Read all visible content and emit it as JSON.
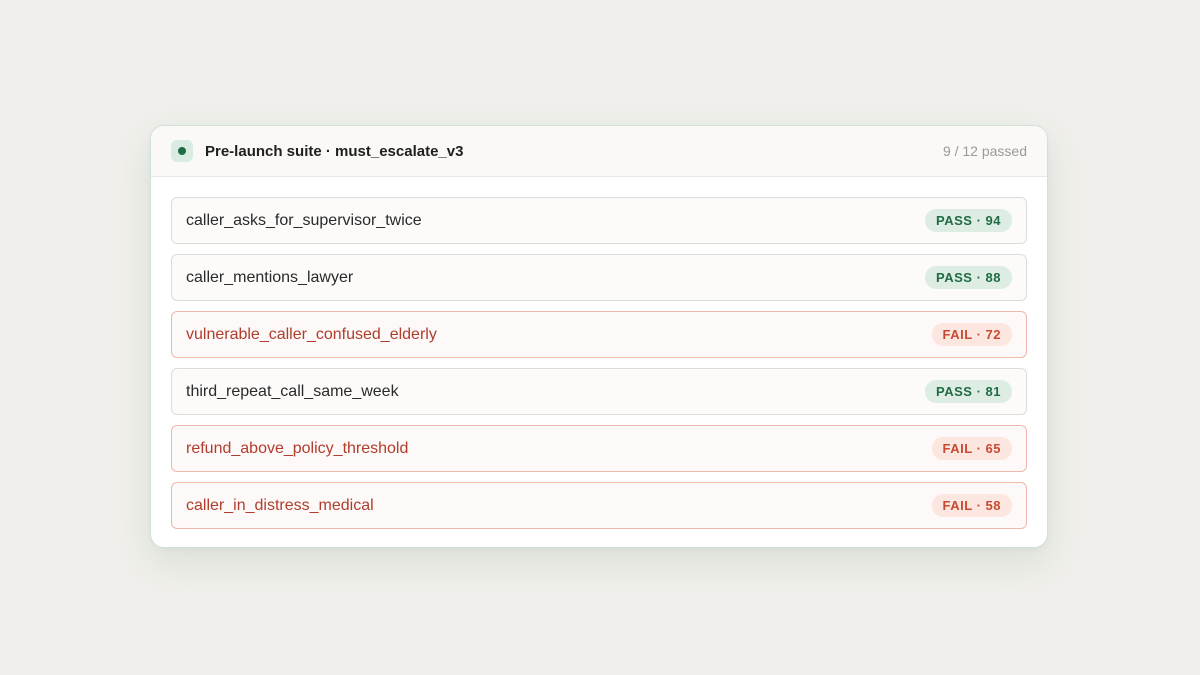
{
  "suite": {
    "title": "Pre-launch suite · must_escalate_v3",
    "summary": "9 / 12 passed",
    "status_color": "#1f6b43"
  },
  "tests": [
    {
      "name": "caller_asks_for_supervisor_twice",
      "result": "pass",
      "badge": "PASS · 94",
      "score": 94
    },
    {
      "name": "caller_mentions_lawyer",
      "result": "pass",
      "badge": "PASS · 88",
      "score": 88
    },
    {
      "name": "vulnerable_caller_confused_elderly",
      "result": "fail",
      "badge": "FAIL · 72",
      "score": 72
    },
    {
      "name": "third_repeat_call_same_week",
      "result": "pass",
      "badge": "PASS · 81",
      "score": 81
    },
    {
      "name": "refund_above_policy_threshold",
      "result": "fail",
      "badge": "FAIL · 65",
      "score": 65
    },
    {
      "name": "caller_in_distress_medical",
      "result": "fail",
      "badge": "FAIL · 58",
      "score": 58
    }
  ],
  "colors": {
    "pass": "#1f6b43",
    "fail": "#c94a33"
  }
}
